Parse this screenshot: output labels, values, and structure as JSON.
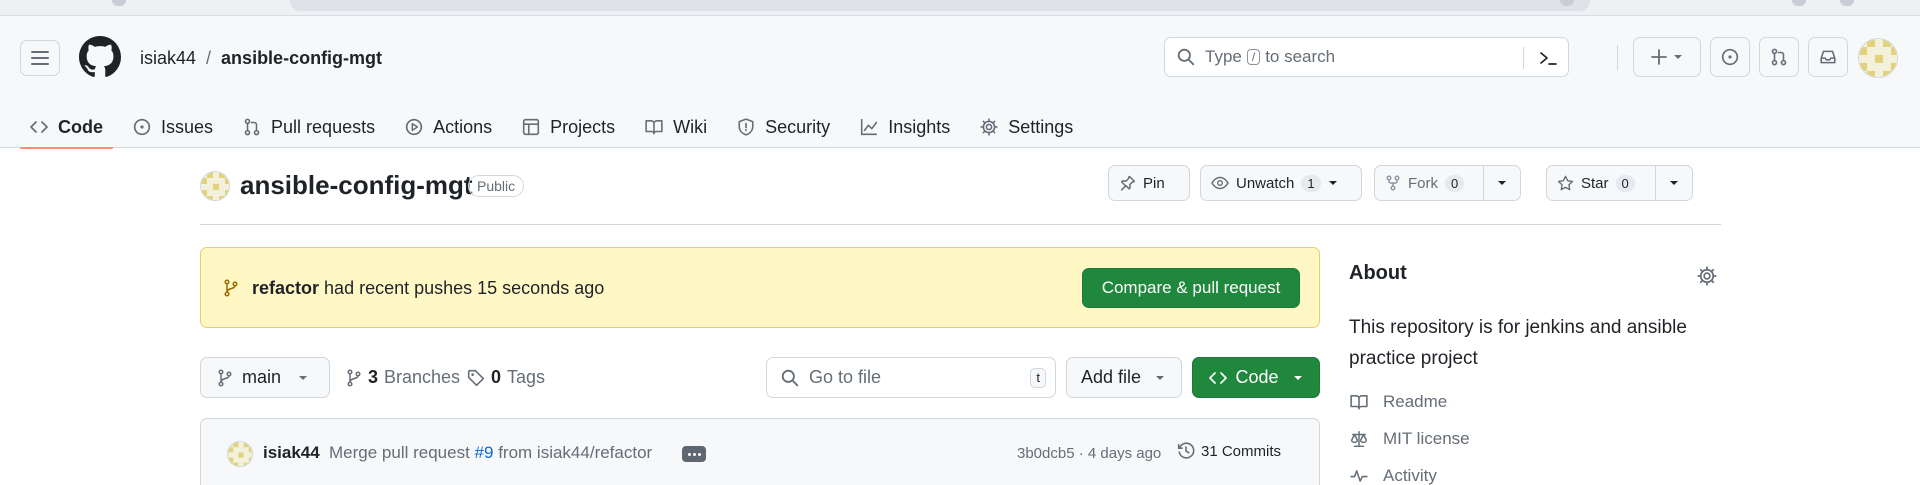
{
  "colors": {
    "accent_green": "#1f883d",
    "link_blue": "#0969da",
    "nav_underline": "#fd8c73",
    "banner_bg": "#fff8c5"
  },
  "header": {
    "owner": "isiak44",
    "separator": "/",
    "repo": "ansible-config-mgt",
    "search_placeholder_before": "Type",
    "search_shortcut": "/",
    "search_placeholder_after": "to search"
  },
  "repo_nav": {
    "tabs": [
      {
        "label": "Code",
        "icon": "code-icon",
        "selected": true
      },
      {
        "label": "Issues",
        "icon": "issue-opened-icon"
      },
      {
        "label": "Pull requests",
        "icon": "git-pull-request-icon"
      },
      {
        "label": "Actions",
        "icon": "play-icon"
      },
      {
        "label": "Projects",
        "icon": "table-icon"
      },
      {
        "label": "Wiki",
        "icon": "book-icon"
      },
      {
        "label": "Security",
        "icon": "shield-icon"
      },
      {
        "label": "Insights",
        "icon": "graph-icon"
      },
      {
        "label": "Settings",
        "icon": "gear-icon"
      }
    ]
  },
  "repo_header": {
    "title": "ansible-config-mgt",
    "visibility": "Public",
    "pin_label": "Pin",
    "watch_label": "Unwatch",
    "watch_count": "1",
    "fork_label": "Fork",
    "fork_count": "0",
    "star_label": "Star",
    "star_count": "0"
  },
  "banner": {
    "branch": "refactor",
    "message": "had recent pushes 15 seconds ago",
    "cta_label": "Compare & pull request"
  },
  "filebar": {
    "branch": "main",
    "branches_count": "3",
    "branches_label": "Branches",
    "tags_count": "0",
    "tags_label": "Tags",
    "goto_placeholder": "Go to file",
    "goto_shortcut": "t",
    "add_file_label": "Add file",
    "code_label": "Code"
  },
  "latest_commit": {
    "author": "isiak44",
    "message_before": "Merge pull request",
    "pr_ref": "#9",
    "message_after": "from isiak44/refactor",
    "sha_time": "3b0dcb5 · 4 days ago",
    "commits_label": "31 Commits"
  },
  "about": {
    "heading": "About",
    "description": "This repository is for jenkins and ansible practice project",
    "links": [
      {
        "label": "Readme",
        "icon": "book-icon"
      },
      {
        "label": "MIT license",
        "icon": "law-icon"
      },
      {
        "label": "Activity",
        "icon": "pulse-icon"
      }
    ]
  }
}
